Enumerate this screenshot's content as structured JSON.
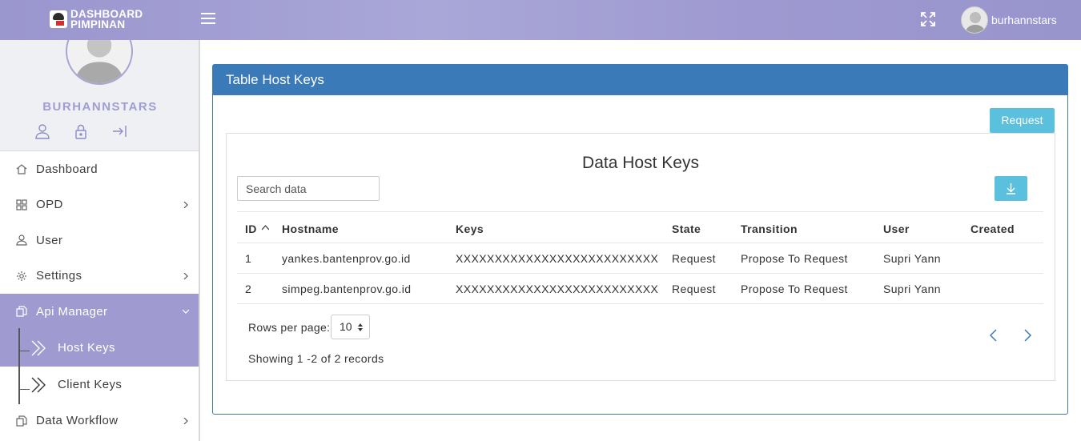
{
  "header": {
    "logo_line1": "DASHBOARD",
    "logo_line2": "PIMPINAN",
    "username": "burhannstars",
    "accent_color": "#9e9ad1"
  },
  "sidebar": {
    "profile_name": "BURHANNSTARS",
    "items": [
      {
        "label": "Dashboard",
        "icon": "home-icon"
      },
      {
        "label": "OPD",
        "icon": "grid-icon",
        "has_children": true
      },
      {
        "label": "User",
        "icon": "user-icon"
      },
      {
        "label": "Settings",
        "icon": "gear-icon",
        "has_children": true
      },
      {
        "label": "Api Manager",
        "icon": "copy-icon",
        "has_children": true,
        "expanded": true
      },
      {
        "label": "Data Workflow",
        "icon": "copy-icon",
        "has_children": true
      }
    ],
    "subitems": [
      {
        "label": "Host Keys",
        "active": true
      },
      {
        "label": "Client Keys",
        "active": false
      }
    ]
  },
  "main": {
    "card_title": "Table Host Keys",
    "request_label": "Request",
    "inner_title": "Data Host Keys",
    "search_placeholder": "Search data",
    "columns": [
      "ID",
      "Hostname",
      "Keys",
      "State",
      "Transition",
      "User",
      "Created"
    ],
    "rows": [
      {
        "id": "1",
        "hostname": "yankes.bantenprov.go.id",
        "keys": "XXXXXXXXXXXXXXXXXXXXXXXXXX",
        "state": "Request",
        "transition": "Propose To Request",
        "user": "Supri Yann",
        "created": ""
      },
      {
        "id": "2",
        "hostname": "simpeg.bantenprov.go.id",
        "keys": "XXXXXXXXXXXXXXXXXXXXXXXXXX",
        "state": "Request",
        "transition": "Propose To Request",
        "user": "Supri Yann",
        "created": ""
      }
    ],
    "rows_per_page_label": "Rows per page:",
    "rows_per_page_value": "10",
    "showing_text": "Showing 1 -2 of 2 records"
  }
}
